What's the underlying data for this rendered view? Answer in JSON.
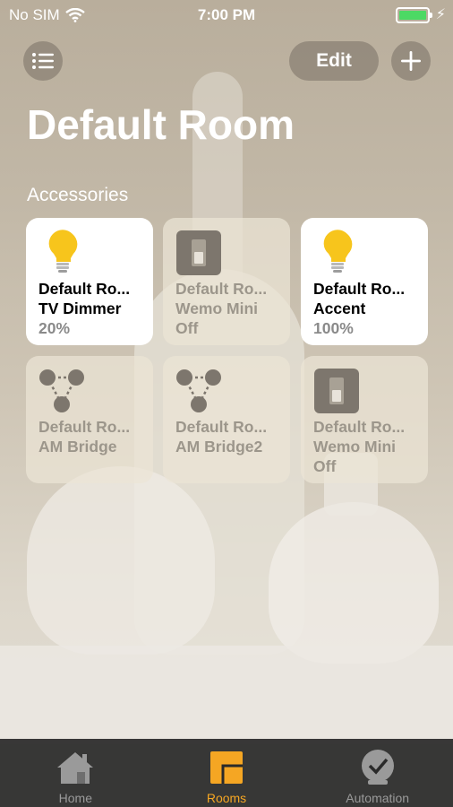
{
  "status_bar": {
    "carrier": "No SIM",
    "time": "7:00 PM"
  },
  "header": {
    "edit_label": "Edit",
    "title": "Default Room"
  },
  "section_label": "Accessories",
  "accessories": [
    {
      "name": "Default Ro...",
      "type": "TV Dimmer",
      "state": "20%",
      "icon": "lightbulb-icon",
      "on": true
    },
    {
      "name": "Default Ro...",
      "type": "Wemo Mini",
      "state": "Off",
      "icon": "switch-icon",
      "on": false
    },
    {
      "name": "Default Ro...",
      "type": "Accent",
      "state": "100%",
      "icon": "lightbulb-icon",
      "on": true
    },
    {
      "name": "Default Ro...",
      "type": "AM Bridge",
      "state": "",
      "icon": "bridge-icon",
      "on": false
    },
    {
      "name": "Default Ro...",
      "type": "AM Bridge2",
      "state": "",
      "icon": "bridge-icon",
      "on": false
    },
    {
      "name": "Default Ro...",
      "type": "Wemo Mini",
      "state": "Off",
      "icon": "switch-icon",
      "on": false
    }
  ],
  "tabs": [
    {
      "label": "Home",
      "icon": "home-icon",
      "active": false
    },
    {
      "label": "Rooms",
      "icon": "rooms-icon",
      "active": true
    },
    {
      "label": "Automation",
      "icon": "automation-icon",
      "active": false
    }
  ],
  "colors": {
    "accent": "#f5a623",
    "bulb": "#f7c51c",
    "battery": "#4cd964"
  }
}
